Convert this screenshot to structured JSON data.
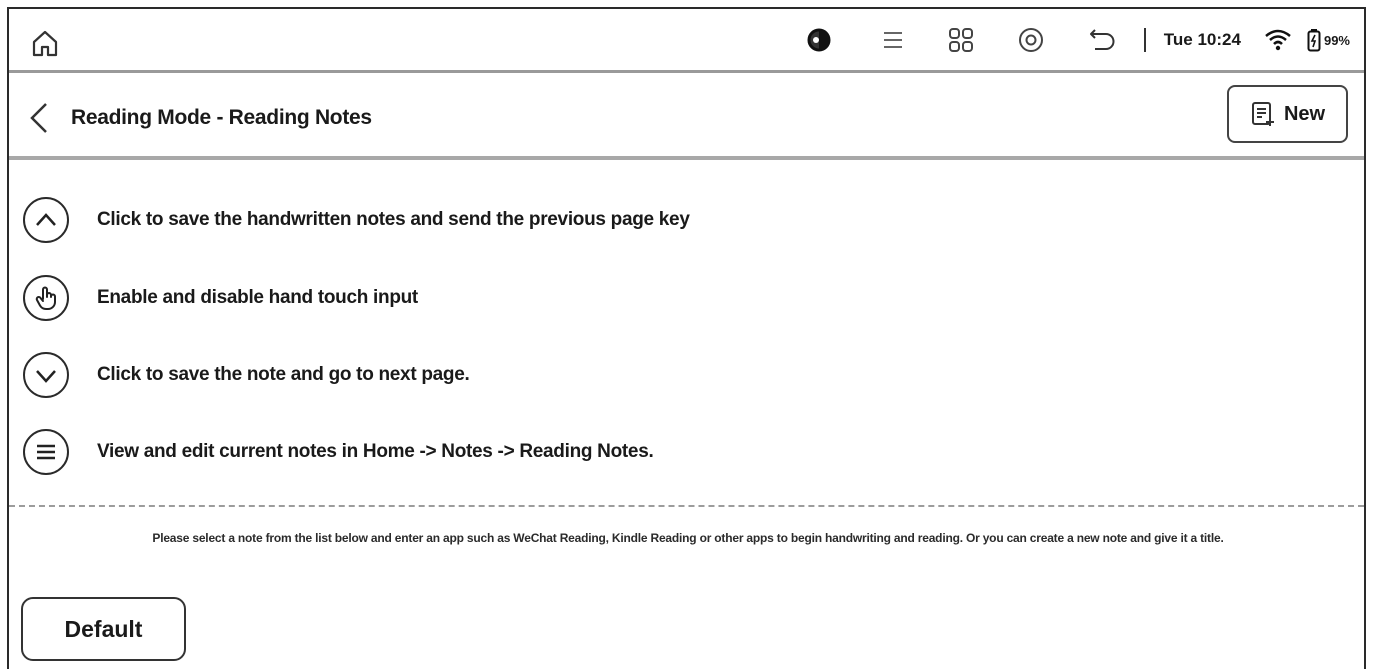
{
  "status_bar": {
    "time": "Tue 10:24",
    "battery": "99%",
    "icons": [
      "home-icon",
      "contrast-icon",
      "menu-icon",
      "apps-icon",
      "settings-icon",
      "back-arrow-icon",
      "wifi-icon",
      "battery-icon"
    ]
  },
  "header": {
    "title": "Reading Mode - Reading Notes",
    "new_label": "New"
  },
  "help_rows": [
    {
      "icon": "chevron-up-icon",
      "text": "Click to save the handwritten notes and send the previous page key"
    },
    {
      "icon": "hand-touch-icon",
      "text": "Enable and disable hand touch input"
    },
    {
      "icon": "chevron-down-icon",
      "text": "Click to save the note and go to next page."
    },
    {
      "icon": "list-menu-icon",
      "text": "View and edit current notes in Home -> Notes -> Reading Notes."
    }
  ],
  "hint": "Please select a note from the list below and enter an app such as WeChat Reading, Kindle Reading or other apps to begin handwriting and reading. Or you can create a new note and give it a title.",
  "notes": [
    {
      "label": "Default"
    }
  ],
  "colors": {
    "ink": "#1a1a1a",
    "divider": "#9a9a9a",
    "background": "#ffffff"
  }
}
